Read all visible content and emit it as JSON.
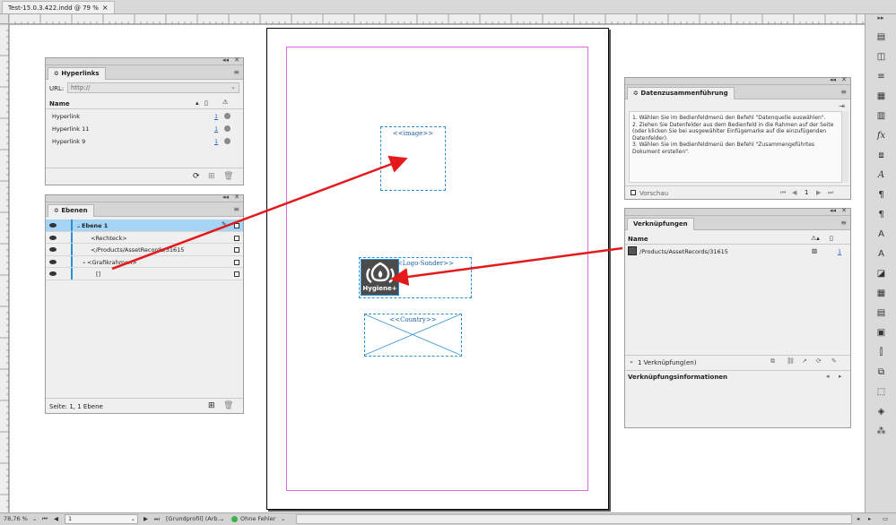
{
  "document": {
    "tab_title": "Test-15.0.3.422.indd @ 79 %"
  },
  "statusbar": {
    "zoom": "78,76 %",
    "page": "1",
    "profile": "[Grundprofil] (Arb...",
    "errors": "Ohne Fehler"
  },
  "hyperlinks_panel": {
    "title": "Hyperlinks",
    "url_label": "URL:",
    "url_value": "http://",
    "col_name": "Name",
    "rows": [
      {
        "name": "Hyperlink",
        "page": "1"
      },
      {
        "name": "Hyperlink 11",
        "page": "1"
      },
      {
        "name": "Hyperlink 9",
        "page": "1"
      }
    ]
  },
  "layers_panel": {
    "title": "Ebenen",
    "rows": [
      {
        "label": "Ebene 1"
      },
      {
        "label": "<Rechteck>"
      },
      {
        "label": "</Products/AssetRecords/31615"
      },
      {
        "label": "<Grafikrahmen>"
      },
      {
        "label": "[]"
      }
    ],
    "footer": "Seite: 1, 1 Ebene"
  },
  "data_merge_panel": {
    "title": "Datenzusammenführung",
    "instructions": "1. Wählen Sie im Bedienfeldmenü den Befehl \"Datenquelle auswählen\".\n2. Ziehen Sie Datenfelder aus dem Bedienfeld in die Rahmen auf der Seite (oder klicken Sie bei ausgewählter Einfügemarke auf die einzufügenden Datenfelder).\n3. Wählen Sie im Bedienfeldmenü den Befehl \"Zusammengeführtes Dokument erstellen\".",
    "preview_label": "Vorschau",
    "record": "1"
  },
  "links_panel": {
    "title": "Verknüpfungen",
    "col_name": "Name",
    "rows": [
      {
        "name": "/Products/AssetRecords/31615",
        "page": "1"
      }
    ],
    "count": "1 Verknüpfung(en)",
    "info_label": "Verknüpfungsinformationen"
  },
  "page": {
    "image_field": "<<image>>",
    "logo_field": "<<Logo-Sonder>>",
    "logo_text": "Hygiene+",
    "country_field": "<<Country>>"
  },
  "colors": {
    "frame": "#2c8fd1",
    "margin": "#d86ee0",
    "arrow": "#e3191b",
    "layer_highlight": "#a6d4f5"
  }
}
